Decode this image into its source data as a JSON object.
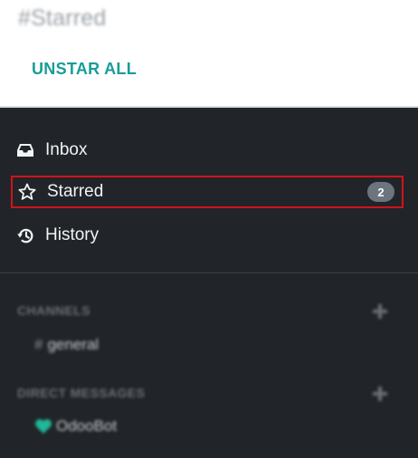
{
  "header": {
    "title": "#Starred",
    "unstar_all_label": "UNSTAR ALL"
  },
  "nav": {
    "items": [
      {
        "label": "Inbox",
        "icon": "inbox-icon"
      },
      {
        "label": "Starred",
        "icon": "star-outline-icon",
        "badge": "2",
        "active": true
      },
      {
        "label": "History",
        "icon": "history-icon"
      }
    ]
  },
  "channels": {
    "header": "CHANNELS",
    "items": [
      {
        "hash": "#",
        "name": "general"
      }
    ]
  },
  "direct_messages": {
    "header": "DIRECT MESSAGES",
    "items": [
      {
        "name": "OdooBot",
        "icon": "heart-icon"
      }
    ]
  },
  "colors": {
    "accent": "#1a9c98",
    "sidebar_bg": "#212529",
    "active_border": "#d0131d",
    "badge_bg": "#6c757d",
    "odoobot_heart": "#21b799"
  }
}
